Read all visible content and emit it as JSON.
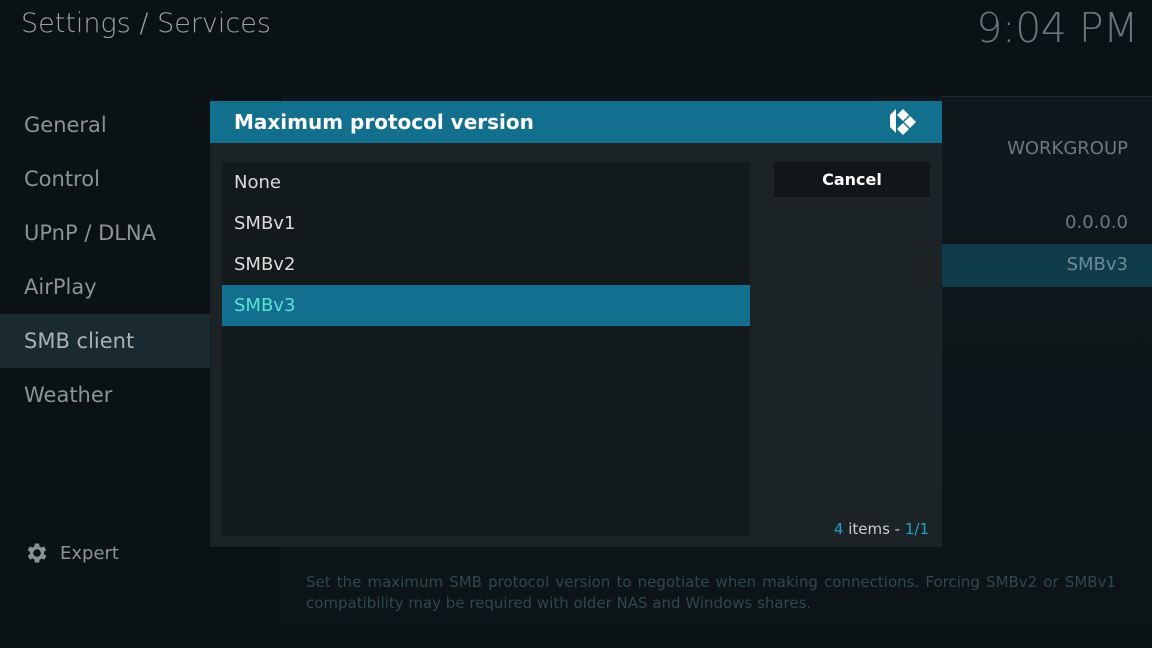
{
  "header": {
    "breadcrumb": "Settings / Services",
    "clock": "9:04 PM"
  },
  "sidebar": {
    "items": [
      {
        "label": "General"
      },
      {
        "label": "Control"
      },
      {
        "label": "UPnP / DLNA"
      },
      {
        "label": "AirPlay"
      },
      {
        "label": "SMB client"
      },
      {
        "label": "Weather"
      }
    ],
    "active_index": 4,
    "expert_label": "Expert"
  },
  "background_settings": {
    "workgroup_value": "WORKGROUP",
    "wins_value": "0.0.0.0",
    "max_protocol_value": "SMBv3",
    "description": "Set the maximum SMB protocol version to negotiate when making connections. Forcing SMBv2 or SMBv1 compatibility may be required with older NAS and Windows shares."
  },
  "dialog": {
    "title": "Maximum protocol version",
    "options": [
      {
        "label": "None"
      },
      {
        "label": "SMBv1"
      },
      {
        "label": "SMBv2"
      },
      {
        "label": "SMBv3"
      }
    ],
    "selected_index": 3,
    "cancel_label": "Cancel",
    "items_count": "4",
    "items_word": " items - ",
    "page": "1/1"
  },
  "colors": {
    "accent": "#12708e",
    "selected_text": "#5ce0d4",
    "highlight": "#1fa2c9"
  }
}
